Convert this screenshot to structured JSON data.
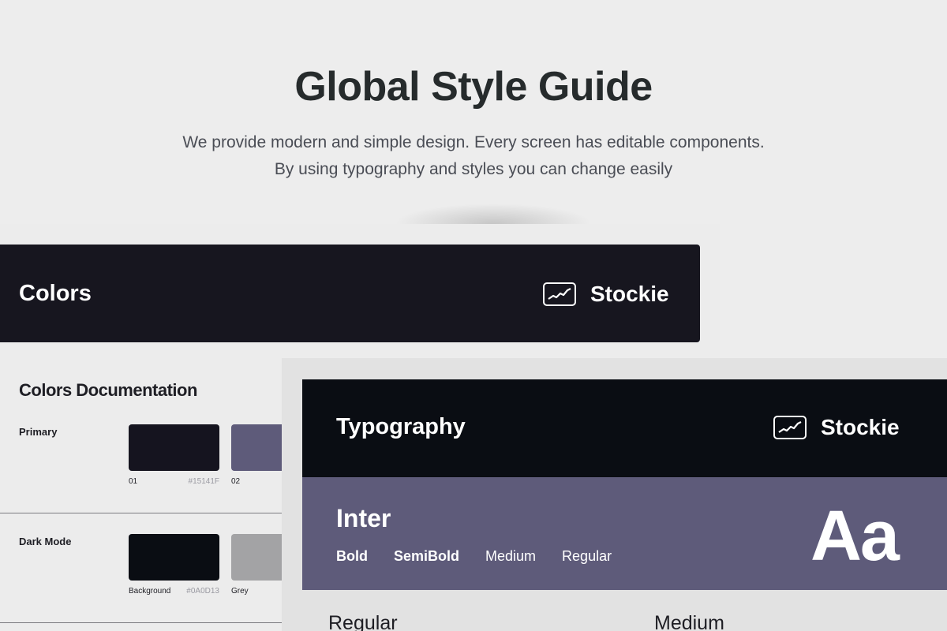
{
  "hero": {
    "title": "Global Style Guide",
    "subtitle_line1": "We provide modern and simple design. Every screen has editable components.",
    "subtitle_line2": "By using typography and styles you can change easily"
  },
  "colors_card": {
    "header_title": "Colors",
    "brand_name": "Stockie",
    "doc_title": "Colors Documentation",
    "rows": [
      {
        "label": "Primary",
        "swatches": [
          {
            "caption": "01",
            "hex": "#15141F",
            "color": "#15141f"
          },
          {
            "caption": "02",
            "hex": "",
            "color": "#5e5b7a"
          }
        ]
      },
      {
        "label": "Dark Mode",
        "swatches": [
          {
            "caption": "Background",
            "hex": "#0A0D13",
            "color": "#0a0d13"
          },
          {
            "caption": "Grey",
            "hex": "",
            "color": "#a3a3a5"
          }
        ]
      }
    ]
  },
  "typography_card": {
    "header_title": "Typography",
    "brand_name": "Stockie",
    "font_name": "Inter",
    "weights": [
      "Bold",
      "SemiBold",
      "Medium",
      "Regular"
    ],
    "sample_glyph": "Aa",
    "footer_left": "Regular",
    "footer_right": "Medium",
    "panel_color": "#5e5b7a"
  },
  "icons": [
    "stock-chart-icon"
  ]
}
